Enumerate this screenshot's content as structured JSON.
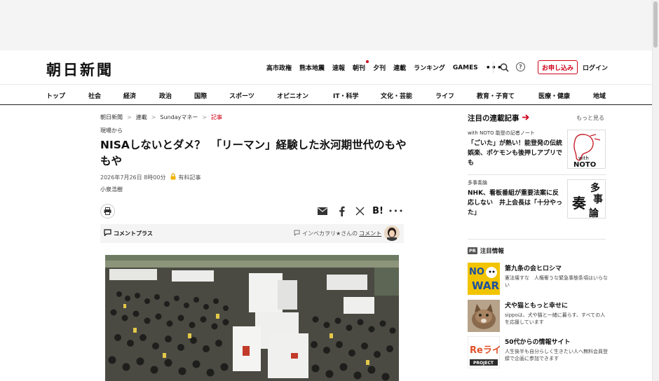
{
  "header": {
    "logo": "朝日新聞",
    "links": [
      {
        "label": "高市政権",
        "dot": false
      },
      {
        "label": "熊本地震",
        "dot": false
      },
      {
        "label": "速報",
        "dot": false
      },
      {
        "label": "朝刊",
        "dot": true
      },
      {
        "label": "夕刊",
        "dot": false
      },
      {
        "label": "連載",
        "dot": false
      },
      {
        "label": "ランキング",
        "dot": false
      },
      {
        "label": "GAMES",
        "dot": false
      }
    ],
    "more": "•••",
    "help": "?",
    "subscribe": "お申し込み",
    "login": "ログイン"
  },
  "categories": [
    "トップ",
    "社会",
    "経済",
    "政治",
    "国際",
    "スポーツ",
    "オピニオン",
    "IT・科学",
    "文化・芸能",
    "ライフ",
    "教育・子育て",
    "医療・健康",
    "地域"
  ],
  "breadcrumb": [
    "朝日新聞",
    "連載",
    "Sundayマネー",
    "記事"
  ],
  "article": {
    "label": "現場から",
    "headline": "NISAしないとダメ？　「リーマン」経験した氷河期世代のもやもや",
    "date": "2026年7月26日 8時00分",
    "paid_label": "有料記事",
    "author": "小泉浩樹"
  },
  "share": {
    "hatena": "B!",
    "more": "•••"
  },
  "comment_bar": {
    "label": "コメントプラス",
    "user": "インベカヲリ★さんの",
    "link": "コメント"
  },
  "sidebar": {
    "title": "注目の連載記事",
    "more": "もっと見る",
    "series": [
      {
        "tag": "with NOTO 能登の記者ノート",
        "title": "「ごいた」が熱い！能登発の伝統娯楽、ポケモンも後押しアプリでも",
        "thumb_text": "with NOTO"
      },
      {
        "tag": "多事奏論",
        "title": "NHK、看板番組が重要法案に反応しない　井上会長は「十分やった」",
        "thumb_text": "多事奏論"
      }
    ],
    "pr_label": "PR",
    "pr_title": "注目情報",
    "ads": [
      {
        "title": "第九条の会ヒロシマ",
        "desc": "憲法壊すな　人権奪うな緊急事態条項はいらない"
      },
      {
        "title": "犬や猫ともっと幸せに",
        "desc": "sippoは、犬や猫と一緒に暮らす、すべての人を応援しています"
      },
      {
        "title": "50代からの情報サイト",
        "desc": "人生後半も自分らしく生きたい人へ無料会員登録で企画に参加できます"
      }
    ],
    "ad3_thumb_word": "Reライフ",
    "ad3_thumb_caption": "PROJECT"
  },
  "colors": {
    "accent": "#d0021b",
    "text": "#111111",
    "muted": "#555555"
  }
}
